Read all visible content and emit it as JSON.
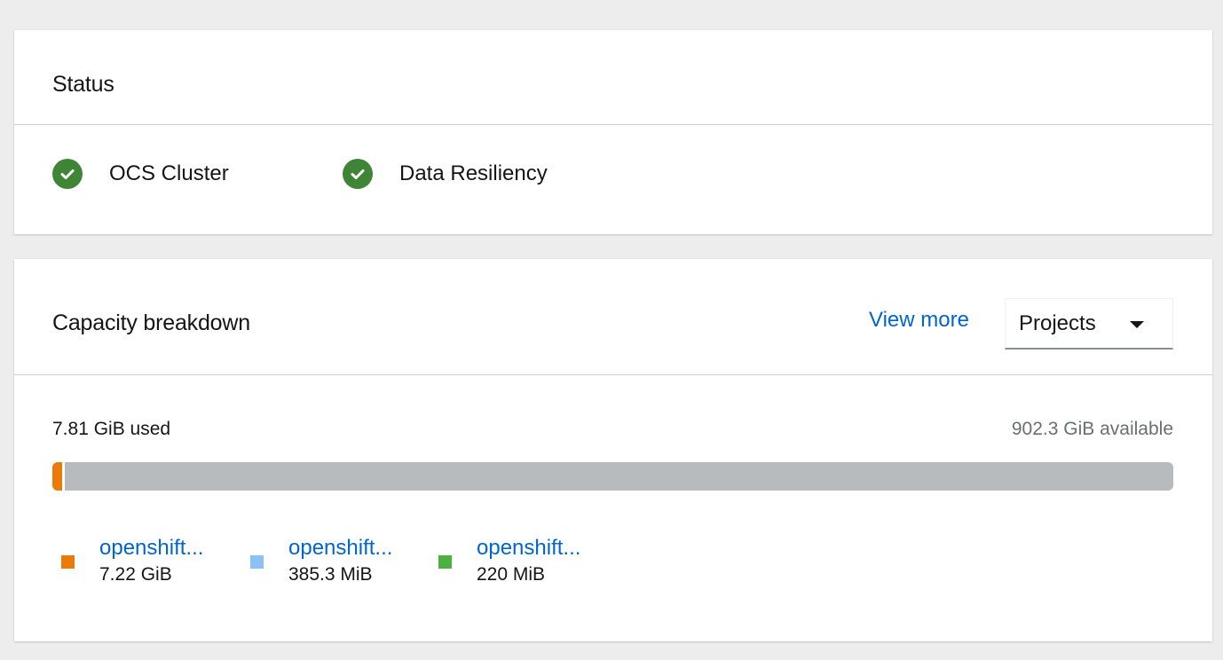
{
  "status_card": {
    "title": "Status",
    "items": [
      {
        "label": "OCS Cluster",
        "icon": "check-circle-icon",
        "state_color": "#3e8635"
      },
      {
        "label": "Data Resiliency",
        "icon": "check-circle-icon",
        "state_color": "#3e8635"
      }
    ]
  },
  "capacity_card": {
    "title": "Capacity breakdown",
    "view_more_label": "View more",
    "dropdown": {
      "selected": "Projects",
      "icon": "caret-down-icon"
    },
    "used_label": "7.81 GiB used",
    "available_label": "902.3 GiB available",
    "usage_fraction": 0.0086,
    "bar_color_used": "#ec7a08",
    "bar_color_available": "#b8bbbe",
    "legend": [
      {
        "name": "openshift...",
        "size": "7.22 GiB",
        "color": "#ec7a08"
      },
      {
        "name": "openshift...",
        "size": "385.3 MiB",
        "color": "#8bc1f7"
      },
      {
        "name": "openshift...",
        "size": "220 MiB",
        "color": "#4cb140"
      }
    ]
  }
}
